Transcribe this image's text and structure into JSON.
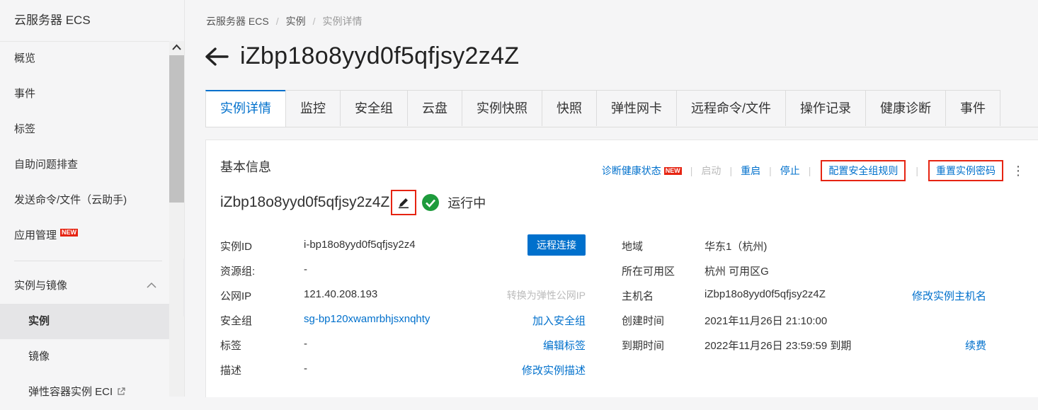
{
  "sidebar": {
    "title": "云服务器 ECS",
    "items": [
      {
        "label": "概览"
      },
      {
        "label": "事件"
      },
      {
        "label": "标签"
      },
      {
        "label": "自助问题排查"
      },
      {
        "label": "发送命令/文件（云助手)"
      },
      {
        "label": "应用管理",
        "badge": "NEW"
      }
    ],
    "group": {
      "label": "实例与镜像",
      "icon": "chevron-up-icon"
    },
    "subitems": [
      {
        "label": "实例",
        "active": true
      },
      {
        "label": "镜像"
      },
      {
        "label": "弹性容器实例 ECI",
        "icon": "external-link-icon"
      }
    ]
  },
  "breadcrumb": [
    "云服务器 ECS",
    "实例",
    "实例详情"
  ],
  "page_title": "iZbp18o8yyd0f5qfjsy2z4Z",
  "tabs": [
    "实例详情",
    "监控",
    "安全组",
    "云盘",
    "实例快照",
    "快照",
    "弹性网卡",
    "远程命令/文件",
    "操作记录",
    "健康诊断",
    "事件"
  ],
  "panel": {
    "section_title": "基本信息",
    "actions": {
      "diagnose": "诊断健康状态",
      "diagnose_badge": "NEW",
      "start": "启动",
      "restart": "重启",
      "stop": "停止",
      "config_sg": "配置安全组规则",
      "reset_pwd": "重置实例密码"
    },
    "instance_name": "iZbp18o8yyd0f5qfjsy2z4Z",
    "status": "运行中",
    "left": {
      "instance_id_label": "实例ID",
      "instance_id": "i-bp18o8yyd0f5qfjsy2z4",
      "remote_btn": "远程连接",
      "resource_group_label": "资源组:",
      "resource_group": "-",
      "public_ip_label": "公网IP",
      "public_ip": "121.40.208.193",
      "eip_link": "转换为弹性公网IP",
      "sg_label": "安全组",
      "sg_value": "sg-bp120xwamrbhjsxnqhty",
      "join_sg": "加入安全组",
      "tag_label": "标签",
      "tag_value": "-",
      "edit_tag": "编辑标签",
      "desc_label": "描述",
      "desc_value": "-",
      "edit_desc": "修改实例描述"
    },
    "right": {
      "region_label": "地域",
      "region": "华东1（杭州)",
      "zone_label": "所在可用区",
      "zone": "杭州 可用区G",
      "host_label": "主机名",
      "host": "iZbp18o8yyd0f5qfjsy2z4Z",
      "edit_host": "修改实例主机名",
      "created_label": "创建时间",
      "created": "2021年11月26日 21:10:00",
      "expire_label": "到期时间",
      "expire": "2022年11月26日 23:59:59 到期",
      "renew": "续费"
    }
  },
  "colors": {
    "accent": "#0070cc",
    "highlight_red": "#e62412",
    "status_green": "#1e9b3c"
  }
}
